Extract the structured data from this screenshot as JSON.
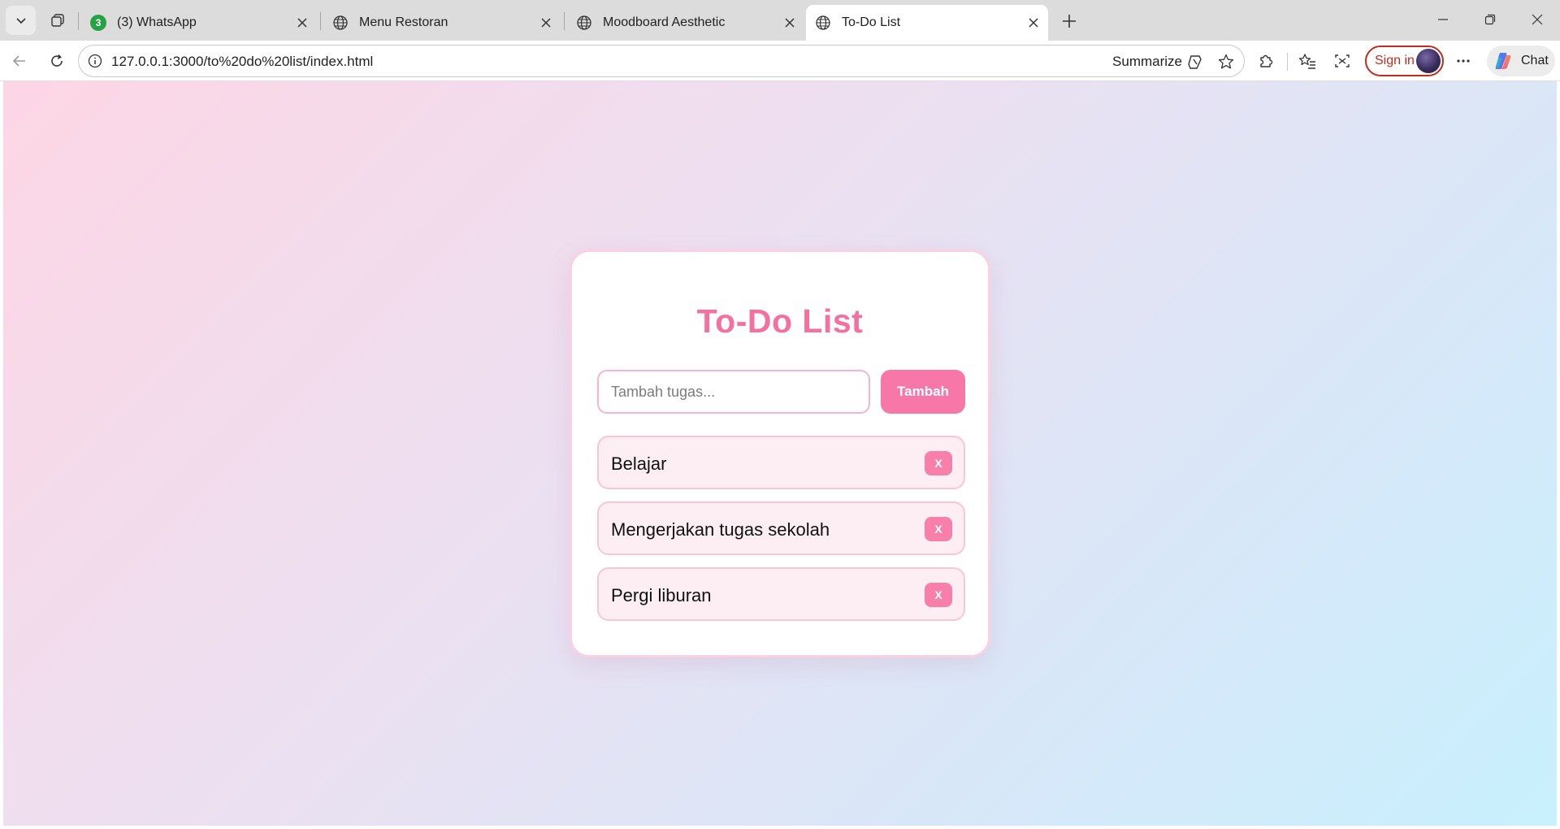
{
  "browser": {
    "tabs": [
      {
        "title": "(3) WhatsApp",
        "badge": "3",
        "icon": "whatsapp-icon",
        "active": false
      },
      {
        "title": "Menu Restoran",
        "icon": "globe-icon",
        "active": false
      },
      {
        "title": "Moodboard Aesthetic",
        "icon": "globe-icon",
        "active": false
      },
      {
        "title": "To-Do List",
        "icon": "globe-icon",
        "active": true
      }
    ],
    "address_bar": {
      "url": "127.0.0.1:3000/to%20do%20list/index.html",
      "summarize_label": "Summarize"
    },
    "sign_in_label": "Sign in",
    "chat_label": "Chat"
  },
  "app": {
    "title": "To-Do List",
    "input": {
      "placeholder": "Tambah tugas...",
      "value": ""
    },
    "add_button_label": "Tambah",
    "tasks": [
      {
        "text": "Belajar",
        "delete_label": "X"
      },
      {
        "text": "Mengerjakan tugas sekolah",
        "delete_label": "X"
      },
      {
        "text": "Pergi liburan",
        "delete_label": "X"
      }
    ]
  },
  "colors": {
    "accent": "#f778a8",
    "title": "#f4709e",
    "card_border": "#fbd1e1",
    "task_bg": "#fdeef4",
    "background_start": "#fdd6e5",
    "background_end": "#c8f0fd"
  }
}
